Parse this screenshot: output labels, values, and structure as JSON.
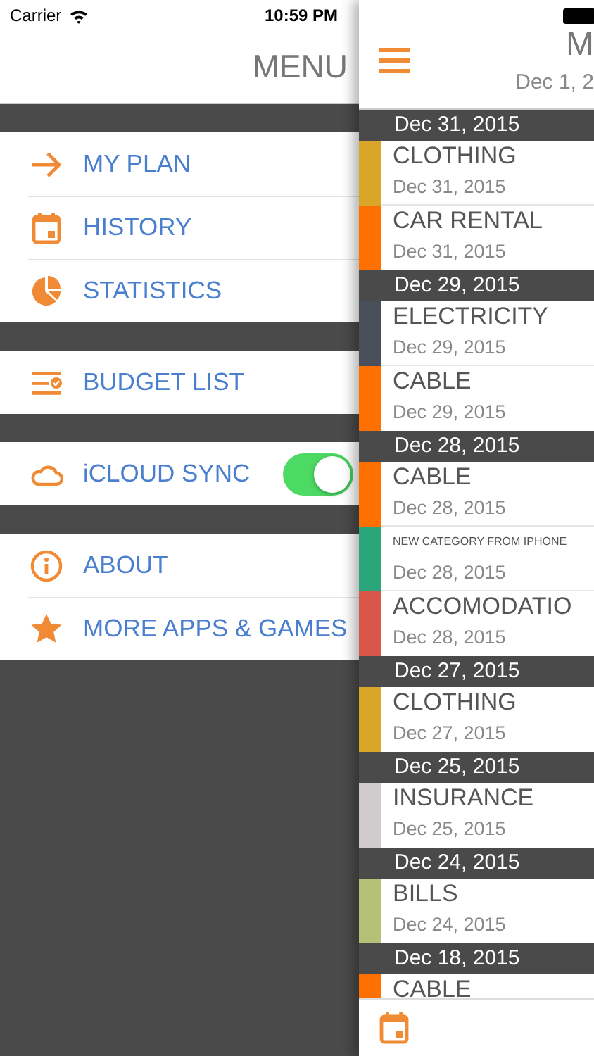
{
  "status_bar": {
    "carrier": "Carrier",
    "time": "10:59 PM"
  },
  "menu": {
    "title": "MENU",
    "groups": [
      {
        "items": [
          {
            "kind": "arrow",
            "label": "MY PLAN"
          },
          {
            "kind": "calendar",
            "label": "HISTORY"
          },
          {
            "kind": "pie",
            "label": "STATISTICS"
          }
        ]
      },
      {
        "items": [
          {
            "kind": "list",
            "label": "BUDGET LIST"
          }
        ]
      },
      {
        "items": [
          {
            "kind": "cloud",
            "label": "iCLOUD SYNC",
            "on": true
          }
        ]
      },
      {
        "items": [
          {
            "kind": "info",
            "label": "ABOUT"
          },
          {
            "kind": "star",
            "label": "MORE APPS & GAMES"
          }
        ]
      }
    ]
  },
  "panel": {
    "title": "M",
    "subtitle": "Dec 1, 2",
    "sections": [
      {
        "date": "Dec 31, 2015",
        "entries": [
          {
            "category": "CLOTHING",
            "date": "Dec 31, 2015",
            "color": "#d9a62a"
          },
          {
            "category": "CAR RENTAL",
            "date": "Dec 31, 2015",
            "color": "#ff7000"
          }
        ]
      },
      {
        "date": "Dec 29, 2015",
        "entries": [
          {
            "category": "ELECTRICITY",
            "date": "Dec 29, 2015",
            "color": "#4a4f5c"
          },
          {
            "category": "CABLE",
            "date": "Dec 29, 2015",
            "color": "#ff7000"
          }
        ]
      },
      {
        "date": "Dec 28, 2015",
        "entries": [
          {
            "category": "CABLE",
            "date": "Dec 28, 2015",
            "color": "#ff7000"
          },
          {
            "category": "NEW CATEGORY FROM IPHONE",
            "date": "Dec 28, 2015",
            "color": "#2ba57a",
            "small": true
          },
          {
            "category": "ACCOMODATIO",
            "date": "Dec 28, 2015",
            "color": "#d9564a"
          }
        ]
      },
      {
        "date": "Dec 27, 2015",
        "entries": [
          {
            "category": "CLOTHING",
            "date": "Dec 27, 2015",
            "color": "#d9a62a"
          }
        ]
      },
      {
        "date": "Dec 25, 2015",
        "entries": [
          {
            "category": "INSURANCE",
            "date": "Dec 25, 2015",
            "color": "#cfcbce"
          }
        ]
      },
      {
        "date": "Dec 24, 2015",
        "entries": [
          {
            "category": "BILLS",
            "date": "Dec 24, 2015",
            "color": "#b5c177"
          }
        ]
      },
      {
        "date": "Dec 18, 2015",
        "entries": [
          {
            "category": "CABLE",
            "color": "#ff7000"
          }
        ]
      }
    ]
  }
}
